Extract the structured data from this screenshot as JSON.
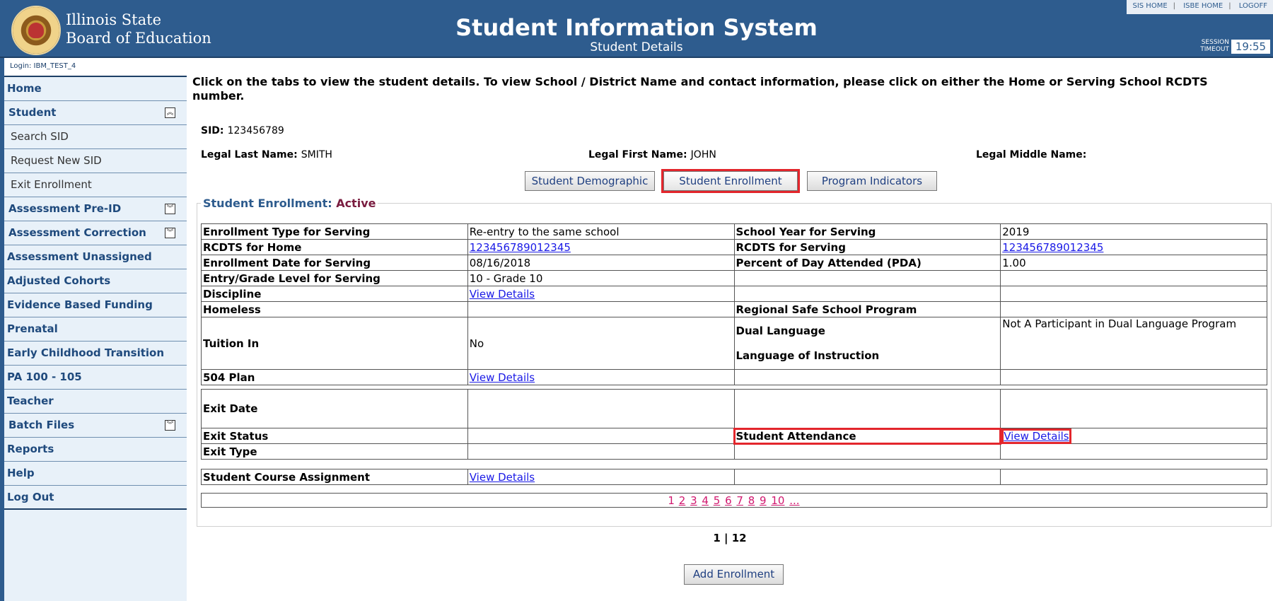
{
  "header": {
    "org_line1": "Illinois State",
    "org_line2": "Board of Education",
    "title": "Student Information System",
    "subtitle": "Student Details",
    "links": [
      "SIS HOME",
      "ISBE HOME",
      "LOGOFF"
    ],
    "session_label_1": "SESSION",
    "session_label_2": "TIMEOUT",
    "session_time": "19:55"
  },
  "sidebar": {
    "login": "Login: IBM_TEST_4",
    "items": [
      {
        "label": "Home"
      },
      {
        "label": "Student",
        "icon": "collapse-up-icon"
      },
      {
        "label": "Search SID"
      },
      {
        "label": "Request New SID"
      },
      {
        "label": "Exit Enrollment"
      },
      {
        "label": "Assessment Pre-ID",
        "icon": "expand-down-icon"
      },
      {
        "label": "Assessment Correction",
        "icon": "expand-down-icon"
      },
      {
        "label": "Assessment Unassigned"
      },
      {
        "label": "Adjusted Cohorts"
      },
      {
        "label": "Evidence Based Funding"
      },
      {
        "label": "Prenatal"
      },
      {
        "label": "Early Childhood Transition"
      },
      {
        "label": "PA 100 - 105"
      },
      {
        "label": "Teacher"
      },
      {
        "label": "Batch Files",
        "icon": "expand-down-icon"
      },
      {
        "label": "Reports"
      },
      {
        "label": "Help"
      },
      {
        "label": "Log Out"
      }
    ]
  },
  "main": {
    "instructions": "Click on the tabs to view the student details. To view School / District Name and contact information, please click on either the Home or Serving School RCDTS number.",
    "sid_label": "SID:",
    "sid_value": "123456789",
    "last_name_label": "Legal Last Name:",
    "last_name_value": "SMITH",
    "first_name_label": "Legal First Name:",
    "first_name_value": "JOHN",
    "middle_name_label": "Legal Middle Name:",
    "middle_name_value": "",
    "tabs": [
      "Student Demographic",
      "Student Enrollment",
      "Program Indicators"
    ],
    "status_label": "Student Enrollment:",
    "status_value": "Active",
    "table": {
      "enrollment_type_label": "Enrollment Type for Serving",
      "enrollment_type_value": "Re-entry to the same school",
      "school_year_label": "School Year for Serving",
      "school_year_value": "2019",
      "rcdts_home_label": "RCDTS for Home",
      "rcdts_home_value": "123456789012345",
      "rcdts_serving_label": "RCDTS for Serving",
      "rcdts_serving_value": "123456789012345",
      "enroll_date_label": "Enrollment Date for Serving",
      "enroll_date_value": "08/16/2018",
      "pda_label": "Percent of Day Attended (PDA)",
      "pda_value": "1.00",
      "grade_label": "Entry/Grade Level for Serving",
      "grade_value": "10 - Grade 10",
      "discipline_label": "Discipline",
      "view_details": "View Details",
      "homeless_label": "Homeless",
      "safe_school_label": "Regional Safe School Program",
      "tuition_label": "Tuition In",
      "tuition_value": "No",
      "dual_language_label": "Dual Language",
      "dual_language_value": "Not A Participant in Dual Language Program",
      "instruction_lang_label": "Language of Instruction",
      "plan504_label": "504 Plan",
      "exit_date_label": "Exit Date",
      "exit_status_label": "Exit Status",
      "attendance_label": "Student Attendance",
      "exit_type_label": "Exit Type",
      "course_label": "Student Course Assignment"
    },
    "pagination": [
      "1",
      "2",
      "3",
      "4",
      "5",
      "6",
      "7",
      "8",
      "9",
      "10",
      "..."
    ],
    "page_count": "1 | 12",
    "add_button": "Add Enrollment"
  }
}
